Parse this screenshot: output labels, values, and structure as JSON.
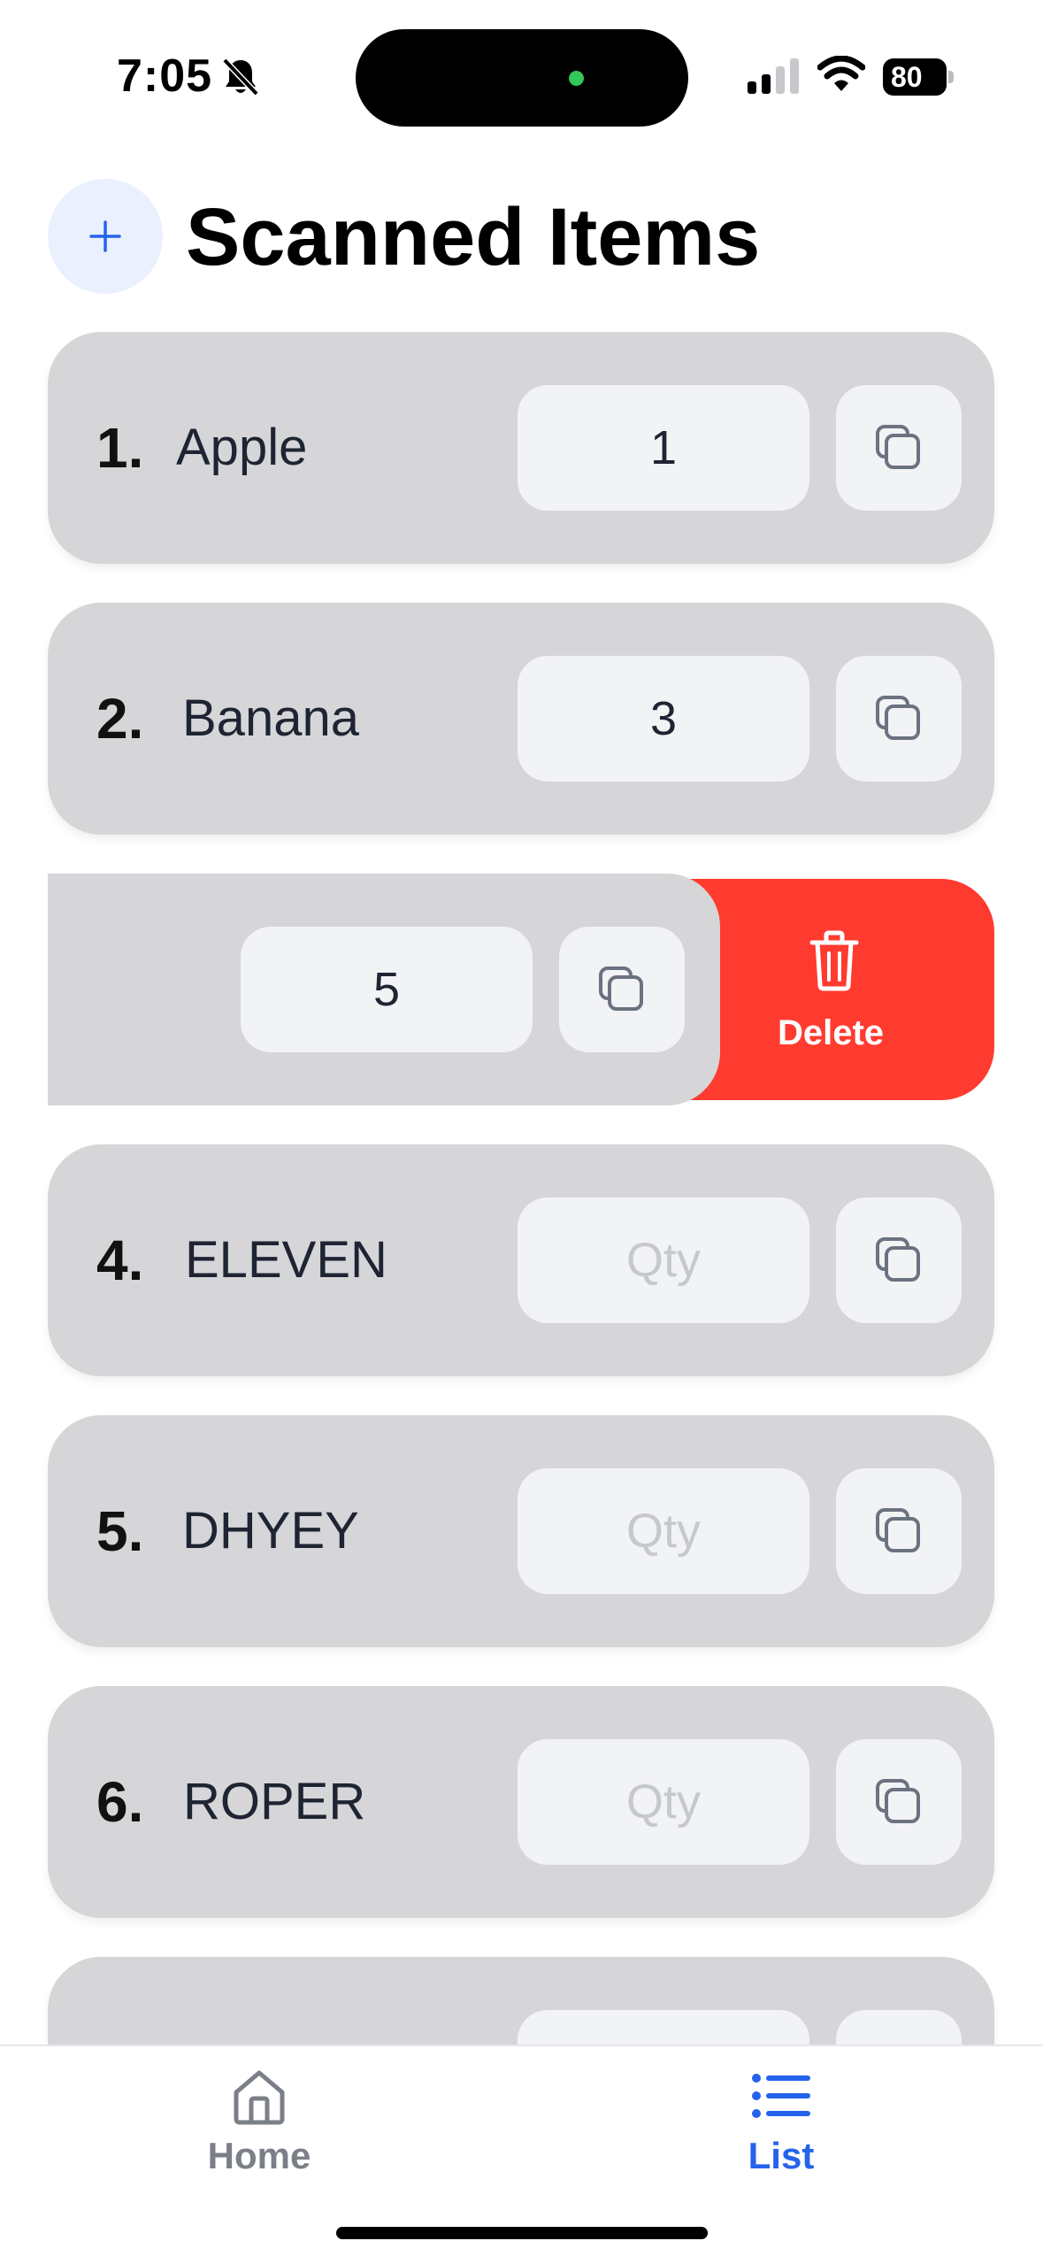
{
  "status_bar": {
    "time": "7:05",
    "battery": "80"
  },
  "header": {
    "add_icon": "plus-icon",
    "title": "Scanned Items"
  },
  "items": [
    {
      "number": "1.",
      "name": "Apple",
      "qty_value": "1",
      "qty_placeholder": "Qty"
    },
    {
      "number": "2.",
      "name": "Banana",
      "qty_value": "3",
      "qty_placeholder": "Qty"
    },
    {
      "number": "",
      "name": "",
      "qty_value": "5",
      "qty_placeholder": "Qty",
      "swiped": true
    },
    {
      "number": "4.",
      "name": "ELEVEN",
      "qty_value": "",
      "qty_placeholder": "Qty"
    },
    {
      "number": "5.",
      "name": "DHYEY",
      "qty_value": "",
      "qty_placeholder": "Qty"
    },
    {
      "number": "6.",
      "name": "ROPER",
      "qty_value": "",
      "qty_placeholder": "Qty"
    },
    {
      "number": "",
      "name": "",
      "qty_value": "",
      "qty_placeholder": ""
    }
  ],
  "swipe_action": {
    "label": "Delete",
    "icon": "trash-icon",
    "color": "#ff3b30"
  },
  "tabbar": {
    "home_label": "Home",
    "list_label": "List",
    "active": "List",
    "active_color": "#2563eb"
  }
}
